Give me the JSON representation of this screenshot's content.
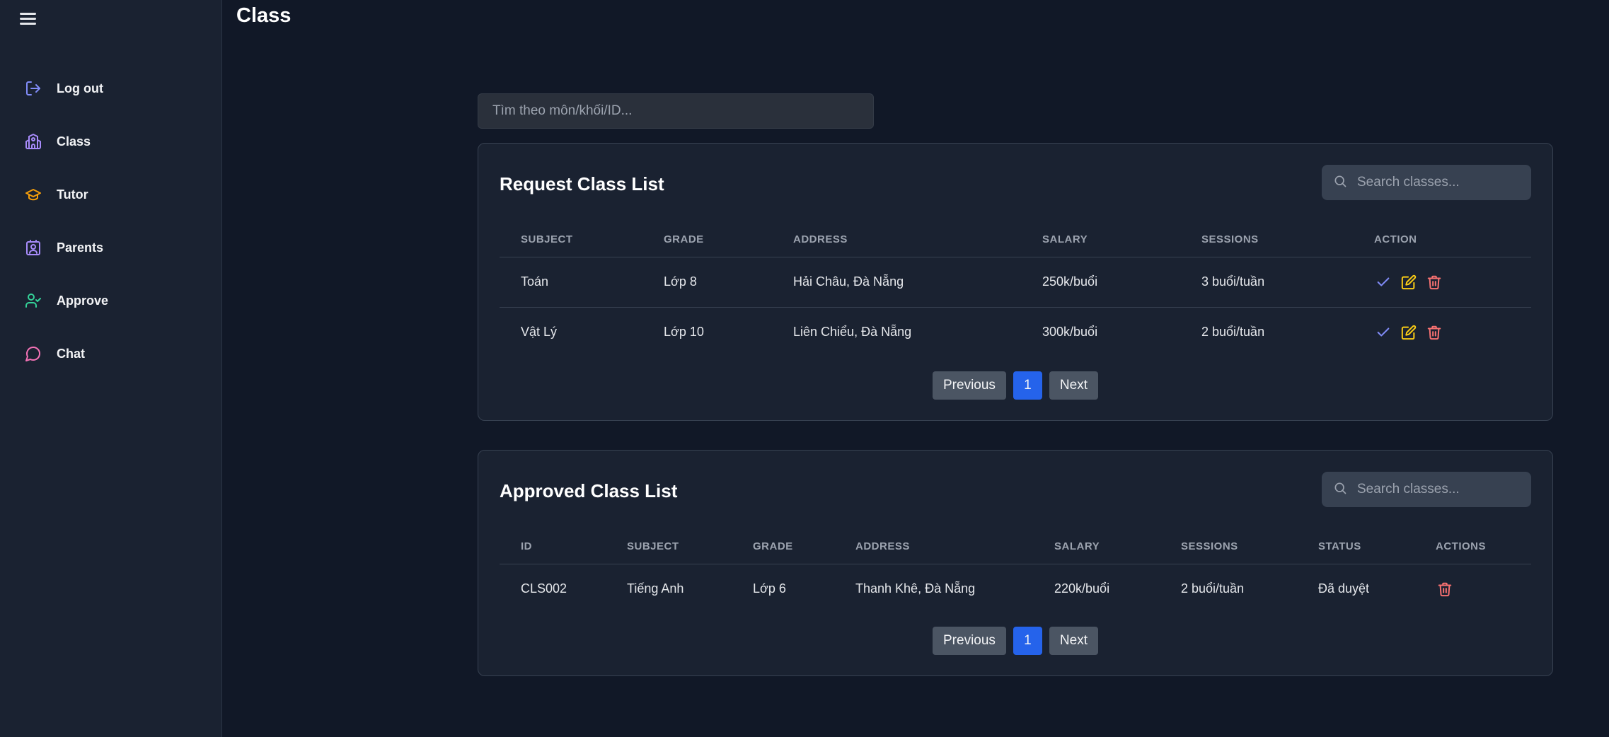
{
  "page": {
    "title": "Class"
  },
  "sidebar": {
    "items": [
      {
        "label": "Log out",
        "icon": "logout-icon",
        "color": "#818cf8"
      },
      {
        "label": "Class",
        "icon": "school-icon",
        "color": "#a78bfa"
      },
      {
        "label": "Tutor",
        "icon": "graduation-cap-icon",
        "color": "#f59e0b"
      },
      {
        "label": "Parents",
        "icon": "contact-icon",
        "color": "#a78bfa"
      },
      {
        "label": "Approve",
        "icon": "user-check-icon",
        "color": "#34d399"
      },
      {
        "label": "Chat",
        "icon": "chat-bubble-icon",
        "color": "#f472b6"
      }
    ]
  },
  "global_search": {
    "placeholder": "Tìm theo môn/khối/ID..."
  },
  "request_list": {
    "title": "Request Class List",
    "search_placeholder": "Search classes...",
    "columns": [
      "SUBJECT",
      "GRADE",
      "ADDRESS",
      "SALARY",
      "SESSIONS",
      "ACTION"
    ],
    "rows": [
      {
        "subject": "Toán",
        "grade": "Lớp 8",
        "address": "Hải Châu, Đà Nẵng",
        "salary": "250k/buổi",
        "sessions": "3 buổi/tuần"
      },
      {
        "subject": "Vật Lý",
        "grade": "Lớp 10",
        "address": "Liên Chiểu, Đà Nẵng",
        "salary": "300k/buổi",
        "sessions": "2 buổi/tuần"
      }
    ],
    "pagination": {
      "previous": "Previous",
      "current": "1",
      "next": "Next"
    }
  },
  "approved_list": {
    "title": "Approved Class List",
    "search_placeholder": "Search classes...",
    "columns": [
      "ID",
      "SUBJECT",
      "GRADE",
      "ADDRESS",
      "SALARY",
      "SESSIONS",
      "STATUS",
      "ACTIONS"
    ],
    "rows": [
      {
        "id": "CLS002",
        "subject": "Tiếng Anh",
        "grade": "Lớp 6",
        "address": "Thanh Khê, Đà Nẵng",
        "salary": "220k/buổi",
        "sessions": "2 buổi/tuần",
        "status": "Đã duyệt"
      }
    ],
    "pagination": {
      "previous": "Previous",
      "current": "1",
      "next": "Next"
    }
  },
  "colors": {
    "background": "#111827",
    "panel": "#1a2231",
    "accent": "#2563eb",
    "approve": "#818cf8",
    "edit": "#facc15",
    "delete": "#f87171"
  }
}
